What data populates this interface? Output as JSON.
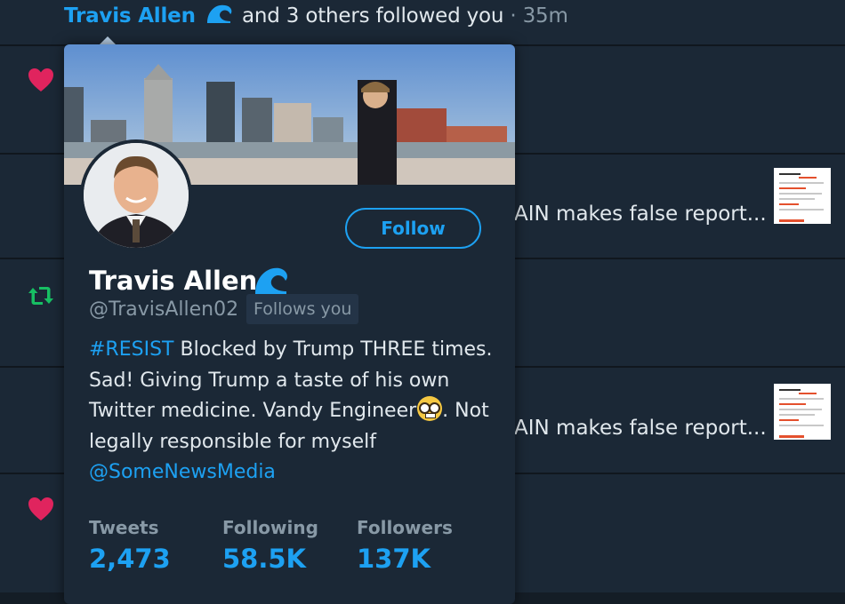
{
  "notification": {
    "actor_name": "Travis Allen",
    "text": "and 3 others followed you",
    "separator": "·",
    "time": "35m"
  },
  "background_rows": {
    "row2_text": "AIN makes false report...",
    "row4_text": "AIN makes false report..."
  },
  "colors": {
    "accent": "#1da1f2",
    "background": "#141d26",
    "card": "#1b2836",
    "like": "#e0245e",
    "retweet": "#17bf63"
  },
  "icons": [
    "wave-verified-icon",
    "heart-icon",
    "retweet-icon"
  ],
  "profile_card": {
    "name": "Travis Allen",
    "handle": "@TravisAllen02",
    "follows_you": "Follows you",
    "follow_label": "Follow",
    "bio_hashtag": "#RESIST",
    "bio_line1": "Blocked by Trump THREE times.",
    "bio_line2": "Sad! Giving Trump a taste of his own",
    "bio_line3a": "Twitter medicine. Vandy Engineer",
    "bio_line3b": ". Not",
    "bio_line4": "legally responsible for myself",
    "bio_mention": "@SomeNewsMedia",
    "stats": {
      "tweets_label": "Tweets",
      "tweets": "2,473",
      "following_label": "Following",
      "following": "58.5K",
      "followers_label": "Followers",
      "followers": "137K"
    }
  }
}
